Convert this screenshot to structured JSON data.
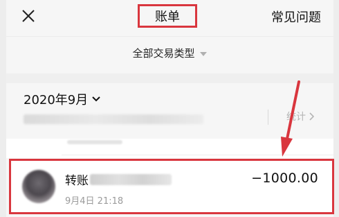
{
  "header": {
    "close_icon": "close-icon",
    "title": "账单",
    "faq_label": "常见问题"
  },
  "filter": {
    "label": "全部交易类型",
    "caret_icon": "caret-down-icon"
  },
  "month_section": {
    "month_label": "2020年9月",
    "month_chevron_icon": "chevron-down-icon",
    "stats_label": "统计",
    "stats_chevron_icon": "chevron-right-icon"
  },
  "transaction": {
    "title": "转账",
    "time": "9月4日 21:18",
    "amount": "−1000.00",
    "avatar_icon": "avatar"
  },
  "annotation": {
    "color": "#d9363e",
    "arrow_icon": "arrow-down-icon"
  }
}
